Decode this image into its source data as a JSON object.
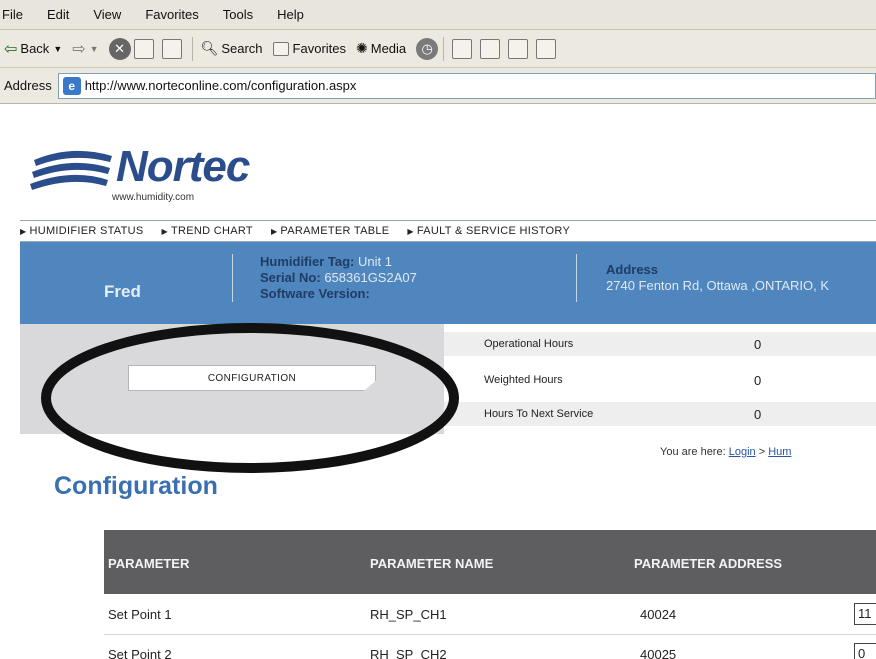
{
  "browser": {
    "menu": [
      "File",
      "Edit",
      "View",
      "Favorites",
      "Tools",
      "Help"
    ],
    "toolbar": {
      "back": "Back",
      "search": "Search",
      "favorites": "Favorites",
      "media": "Media"
    },
    "address_label": "Address",
    "url": "http://www.norteconline.com/configuration.aspx"
  },
  "logo": {
    "name": "Nortec",
    "subtitle": "www.humidity.com"
  },
  "nav": [
    "HUMIDIFIER STATUS",
    "TREND CHART",
    "PARAMETER TABLE",
    "FAULT & SERVICE HISTORY"
  ],
  "info": {
    "left_text": "Fred",
    "tag_label": "Humidifier Tag:",
    "tag_value": "Unit 1",
    "serial_label": "Serial No:",
    "serial_value": "658361GS2A07",
    "software_label": "Software Version:",
    "address_label": "Address",
    "address_value": "2740 Fenton Rd, Ottawa ,ONTARIO, K"
  },
  "config_button": "CONFIGURATION",
  "hours": [
    {
      "name": "Operational Hours",
      "value": "0"
    },
    {
      "name": "Weighted Hours",
      "value": "0"
    },
    {
      "name": "Hours To Next Service",
      "value": "0"
    }
  ],
  "breadcrumb": {
    "prefix": "You are here:",
    "link1": "Login",
    "sep": ">",
    "link2": "Hum"
  },
  "page_title": "Configuration",
  "table": {
    "headers": [
      "PARAMETER",
      "PARAMETER NAME",
      "PARAMETER ADDRESS"
    ],
    "rows": [
      {
        "parameter": "Set Point 1",
        "name": "RH_SP_CH1",
        "address": "40024",
        "input": "11"
      },
      {
        "parameter": "Set Point 2",
        "name": "RH_SP_CH2",
        "address": "40025",
        "input": "0"
      }
    ]
  }
}
